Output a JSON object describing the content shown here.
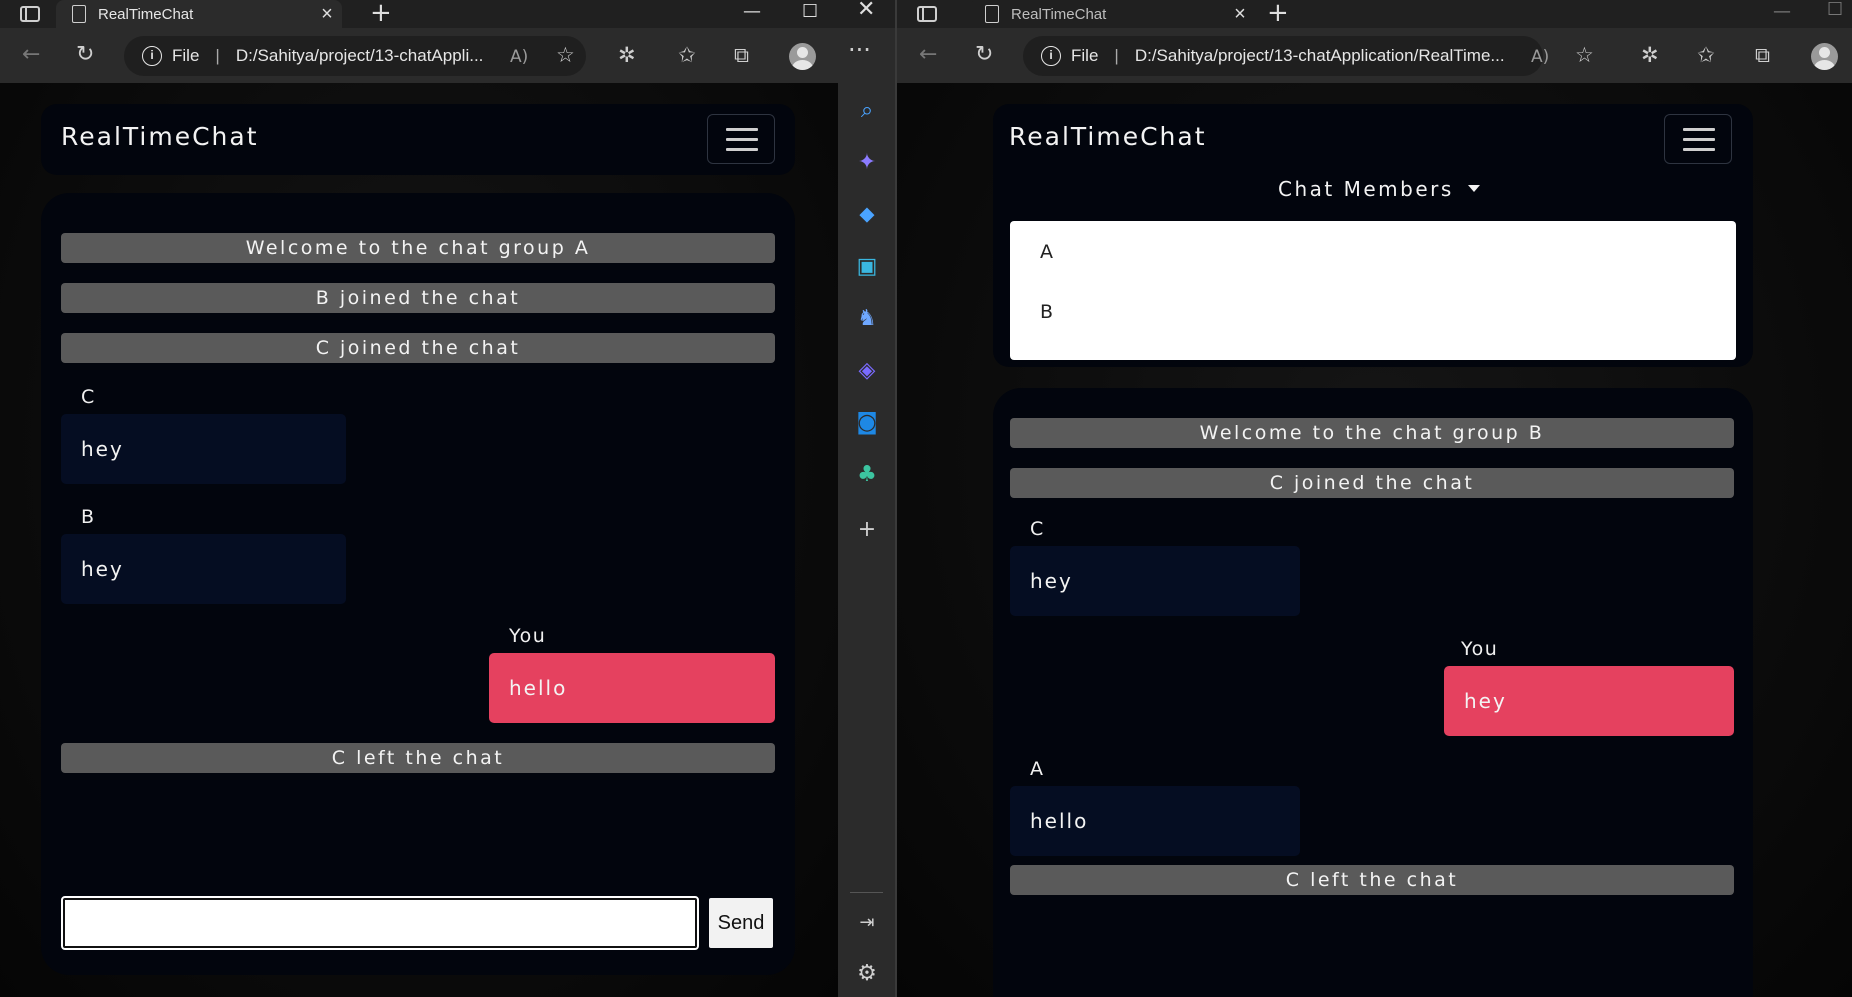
{
  "left_window": {
    "tab_title": "RealTimeChat",
    "address_label": "File",
    "address_url": "D:/Sahitya/project/13-chatAppli...",
    "navbar": {
      "brand": "RealTimeChat"
    },
    "chat": {
      "system_messages": [
        "Welcome to the chat group A",
        "B joined the chat",
        "C joined the chat",
        "C left the chat"
      ],
      "messages": [
        {
          "sender": "C",
          "text": "hey"
        },
        {
          "sender": "B",
          "text": "hey"
        },
        {
          "sender": "You",
          "text": "hello"
        }
      ],
      "input_value": "",
      "send_label": "Send"
    }
  },
  "right_window": {
    "tab_title": "RealTimeChat",
    "address_label": "File",
    "address_url": "D:/Sahitya/project/13-chatApplication/RealTime...",
    "navbar": {
      "brand": "RealTimeChat",
      "members_toggle": "Chat Members",
      "members": [
        "A",
        "B"
      ]
    },
    "chat": {
      "system_messages": [
        "Welcome to the chat group B",
        "C joined the chat",
        "C left the chat"
      ],
      "messages": [
        {
          "sender": "C",
          "text": "hey"
        },
        {
          "sender": "You",
          "text": "hey"
        },
        {
          "sender": "A",
          "text": "hello"
        }
      ]
    }
  },
  "browser_glyphs": {
    "read_aloud": "A)",
    "more": "···"
  },
  "sidebar_icons": [
    "search-icon",
    "copilot-icon",
    "shopping-icon",
    "tools-icon",
    "games-icon",
    "office-icon",
    "outlook-icon",
    "drop-icon",
    "add-icon",
    "hide-sidebar-icon",
    "settings-icon"
  ],
  "colors": {
    "my_bubble": "#e5415f",
    "other_bubble": "#050d22",
    "system_bar": "#5a5a5a",
    "card": "#02050d"
  }
}
